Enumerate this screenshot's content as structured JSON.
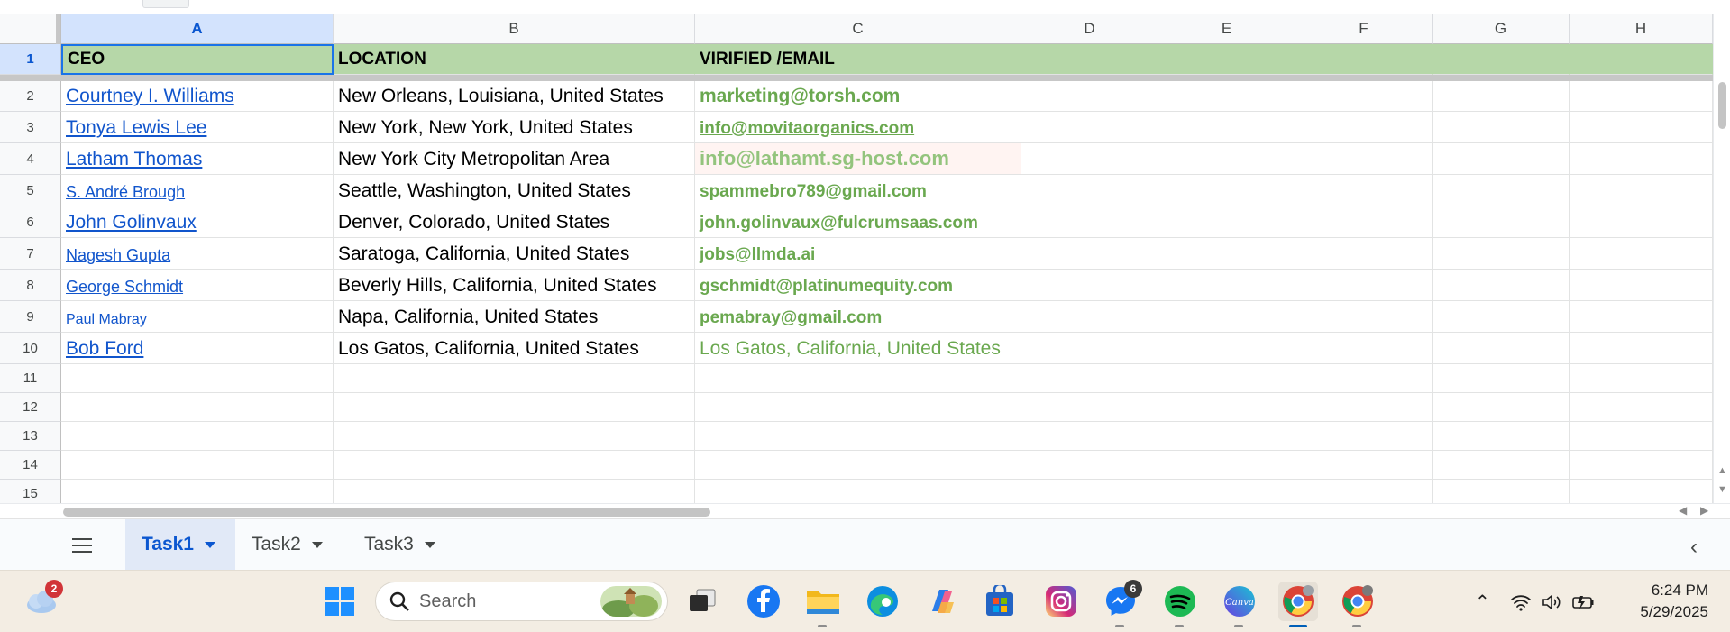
{
  "columns": [
    "A",
    "B",
    "C",
    "D",
    "E",
    "F",
    "G",
    "H"
  ],
  "selected_column": "A",
  "header_row": {
    "number": "1",
    "ceo": "CEO",
    "location": "LOCATION",
    "email": "VIRIFIED /EMAIL"
  },
  "rows": [
    {
      "number": "2",
      "ceo": "Courtney I. Williams",
      "location": "New Orleans, Louisiana, United States",
      "email": "marketing@torsh.com"
    },
    {
      "number": "3",
      "ceo": "Tonya Lewis Lee",
      "location": "New York, New York, United States",
      "email": "info@movitaorganics.com"
    },
    {
      "number": "4",
      "ceo": "Latham Thomas",
      "location": "New York City Metropolitan Area",
      "email": "info@lathamt.sg-host.com"
    },
    {
      "number": "5",
      "ceo": "S. André Brough",
      "location": "Seattle, Washington, United States",
      "email": "spammebro789@gmail.com"
    },
    {
      "number": "6",
      "ceo": "John Golinvaux",
      "location": "Denver, Colorado, United States",
      "email": "john.golinvaux@fulcrumsaas.com"
    },
    {
      "number": "7",
      "ceo": "Nagesh Gupta",
      "location": "Saratoga, California, United States",
      "email": "jobs@llmda.ai"
    },
    {
      "number": "8",
      "ceo": "George Schmidt",
      "location": "Beverly Hills, California, United States",
      "email": "gschmidt@platinumequity.com"
    },
    {
      "number": "9",
      "ceo": "Paul Mabray",
      "location": "Napa, California, United States",
      "email": "pemabray@gmail.com"
    },
    {
      "number": "10",
      "ceo": "Bob Ford",
      "location": "Los Gatos, California, United States",
      "email": "Los Gatos, California, United States"
    }
  ],
  "empty_rows": [
    "11",
    "12",
    "13",
    "14",
    "15"
  ],
  "sheet_tabs": [
    {
      "label": "Task1",
      "active": true
    },
    {
      "label": "Task2",
      "active": false
    },
    {
      "label": "Task3",
      "active": false
    }
  ],
  "taskbar": {
    "search_placeholder": "Search",
    "weather_badge": "2",
    "messenger_badge": "6",
    "apps": [
      "weather-icon",
      "windows-start-icon",
      "search-icon",
      "task-view-icon",
      "facebook-icon",
      "file-explorer-icon",
      "edge-icon",
      "copilot-icon",
      "microsoft-store-icon",
      "instagram-icon",
      "messenger-icon",
      "spotify-icon",
      "canva-icon",
      "chrome-icon",
      "chrome-icon"
    ],
    "canva_label": "Canva",
    "time": "6:24 PM",
    "date": "5/29/2025"
  },
  "colors": {
    "header_fill": "#b6d7a8",
    "email_green": "#6aa84f",
    "link_blue": "#1155cc",
    "selection_blue": "#1a73e8"
  }
}
